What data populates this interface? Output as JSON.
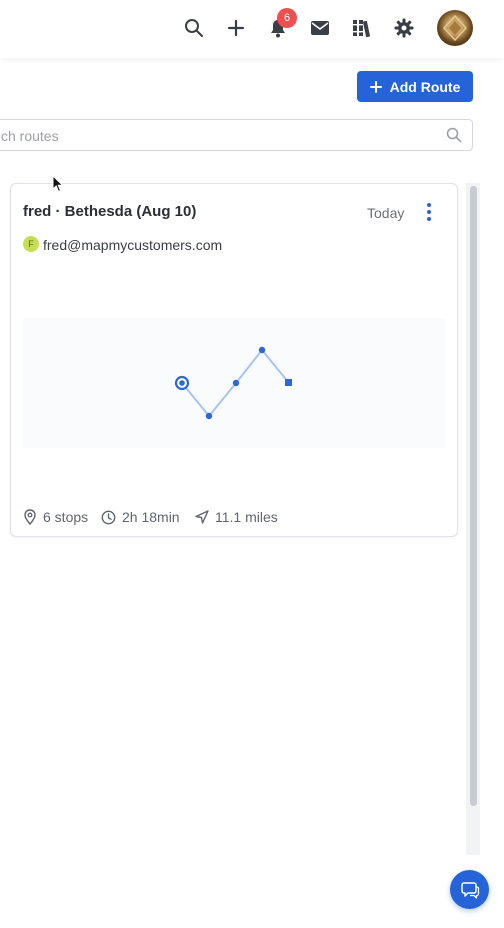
{
  "header": {
    "notifications_count": "6",
    "icons": [
      "search-icon",
      "plus-icon",
      "bell-icon",
      "mail-icon",
      "library-icon",
      "gear-icon",
      "avatar"
    ]
  },
  "toolbar": {
    "add_route_label": "Add Route"
  },
  "search": {
    "placeholder": "ch routes"
  },
  "route_card": {
    "title": "fred · Bethesda (Aug 10)",
    "date": "Today",
    "owner_initial": "F",
    "owner_email": "fred@mapmycustomers.com",
    "stops": "6 stops",
    "duration": "2h 18min",
    "distance": "11.1 miles"
  },
  "colors": {
    "accent": "#2563d9",
    "badge": "#ef4f4f",
    "owner_dot": "#c6de55",
    "route_line": "#a9c4ef"
  }
}
